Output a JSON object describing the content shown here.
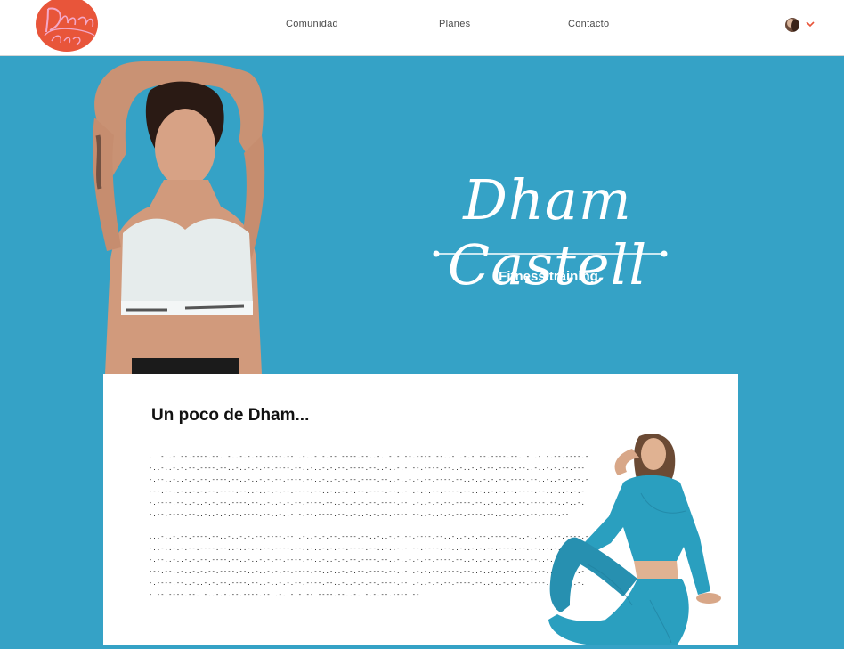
{
  "nav": {
    "logo_text": "Dham Castell",
    "links": [
      "Comunidad",
      "Planes",
      "Contacto"
    ],
    "accent": "#e8553a"
  },
  "hero": {
    "title": "Dham Castell",
    "subtitle": "Fitness training",
    "background": "#35a2c6"
  },
  "about": {
    "title": "Un poco de Dham...",
    "paragraph_1": "...-..-.--.----.--..-..-.-.--.----.--..-..-.-.--.----.--..-..-.-.--.----.--..-..-.-.--.----.--..-..-.-.--.----.--..-..-.-.--.----.--..-..-.-.--.----.--..-..-.-.--.----.--..-..-.-.--.----.--..-..-.-.--.----.--..-..-.-.--.----.--..-..-.-.--.----.--..-..-.-.--.----.--..-..-.-.--.----.--..-..-.-.--.----.--..-..-.-.--.----.--..-..-.-.--.----.--..-..-.-.--.----.--..-..-.-.--.----.--..-..-.-.--.----.--..-..-.-.--.----.--..-..-.-.--.----.--..-..-.-.--.----.--..-..-.-.--.----.--..-..-.-.--.----.--..-..-.-.--.----.--..-..-.-.--.----.--..-..-.-.--.----.--..-..-.-.--.----.--..-..-.-.--.----.--..-..-.-.--.----.--..-..-.-.--.----.--..-..-.-.--.----.--..-..-.-.--.----.--",
    "paragraph_2": "...-..-.--.----.--..-..-.-.--.----.--..-..-.-.--.----.--..-..-.-.--.----.--..-..-.-.--.----.--..-..-.-.--.----.--..-..-.-.--.----.--..-..-.-.--.----.--..-..-.-.--.----.--..-..-.-.--.----.--..-..-.-.--.----.--..-..-.-.--.----.--..-..-.-.--.----.--..-..-.-.--.----.--..-..-.-.--.----.--..-..-.-.--.----.--..-..-.-.--.----.--..-..-.-.--.----.--..-..-.-.--.----.--..-..-.-.--.----.--..-..-.-.--.----.--..-..-.-.--.----.--..-..-.-.--.----.--..-..-.-.--.----.--..-..-.-.--.----.--..-..-.-.--.----.--..-..-.-.--.----.--..-..-.-.--.----.--..-..-.-.--.----.--..-..-.-.--.----.--..-..-.-.--.----.--..-..-.-.--.----.--..-..-.-.--.----.--"
  },
  "colors": {
    "sportswear": "#2a9fbf",
    "bra": "#e6ecec"
  }
}
